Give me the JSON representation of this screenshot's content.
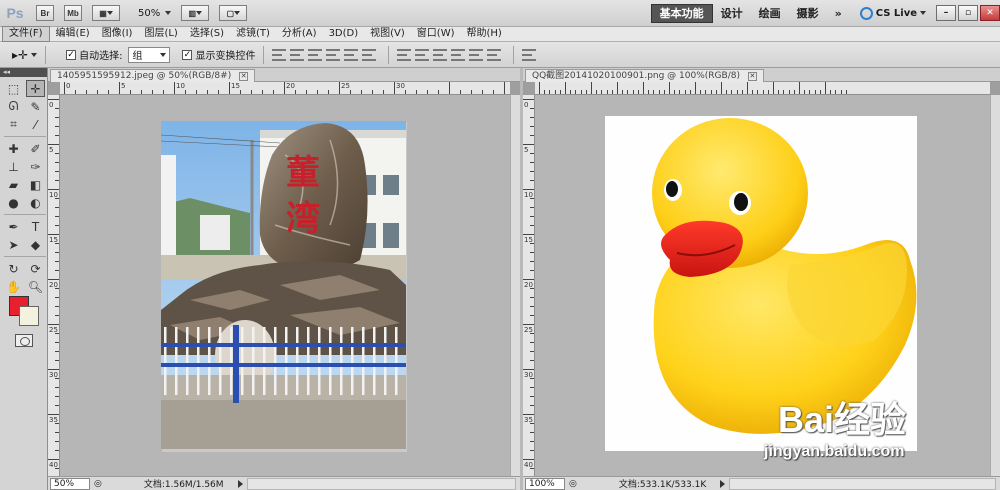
{
  "appbar": {
    "logo": "Ps",
    "bridge_label": "Br",
    "minibridge_label": "Mb",
    "zoom": "50%",
    "workspaces": [
      {
        "label": "基本功能",
        "active": true
      },
      {
        "label": "设计",
        "active": false
      },
      {
        "label": "绘画",
        "active": false
      },
      {
        "label": "摄影",
        "active": false
      }
    ],
    "more": "»",
    "cslive": "CS Live"
  },
  "menu": [
    "文件(F)",
    "编辑(E)",
    "图像(I)",
    "图层(L)",
    "选择(S)",
    "滤镜(T)",
    "分析(A)",
    "3D(D)",
    "视图(V)",
    "窗口(W)",
    "帮助(H)"
  ],
  "options": {
    "auto_select_label": "自动选择:",
    "auto_select_checked": true,
    "auto_select_value": "组",
    "show_transform_label": "显示变换控件",
    "show_transform_checked": true
  },
  "tools": {
    "header": "◂◂",
    "items": [
      "marquee-tool",
      "move-tool",
      "lasso-tool",
      "quick-select-tool",
      "crop-tool",
      "eyedropper-tool",
      "healing-brush-tool",
      "brush-tool",
      "clone-stamp-tool",
      "history-brush-tool",
      "eraser-tool",
      "gradient-tool",
      "blur-tool",
      "dodge-tool",
      "pen-tool",
      "type-tool",
      "path-select-tool",
      "shape-tool",
      "3d-rotate-tool",
      "3d-orbit-tool",
      "hand-tool",
      "zoom-tool"
    ],
    "fg_color": "#e8202e",
    "bg_color": "#f4f1de"
  },
  "doc1": {
    "tab": "1405951595912.jpeg @ 50%(RGB/8#)",
    "ruler_h": [
      "0",
      "5",
      "10",
      "15",
      "20",
      "25",
      "30"
    ],
    "ruler_v": [
      "0",
      "5",
      "10",
      "15",
      "20",
      "25",
      "30",
      "35",
      "40"
    ],
    "zoom": "50%",
    "doc_size": "文档:1.56M/1.56M"
  },
  "doc2": {
    "tab": "QQ截图20141020100901.png @ 100%(RGB/8)",
    "ruler_v": [
      "0",
      "5",
      "10",
      "15",
      "20",
      "25",
      "30",
      "35",
      "40"
    ],
    "zoom": "100%",
    "doc_size": "文档:533.1K/533.1K"
  },
  "photo1": {
    "rock_text": [
      "董",
      "湾"
    ]
  },
  "watermark": {
    "brand": "Bai经验",
    "url": "jingyan.baidu.com"
  }
}
